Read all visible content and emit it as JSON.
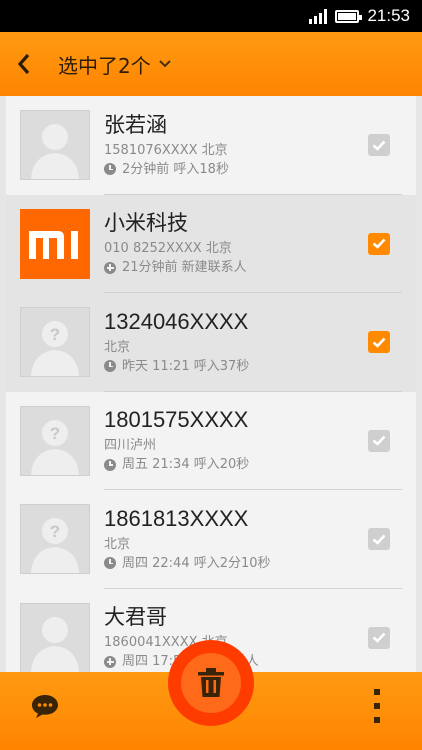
{
  "status_bar": {
    "time": "21:53"
  },
  "action_bar": {
    "title": "选中了2个"
  },
  "contacts": [
    {
      "name": "张若涵",
      "sub": "1581076XXXX 北京",
      "meta": "2分钟前 呼入18秒",
      "meta_icon": "clock-icon",
      "avatar": "person-silhouette",
      "selected": false
    },
    {
      "name": "小米科技",
      "sub": "010 8252XXXX  北京",
      "meta": "21分钟前 新建联系人",
      "meta_icon": "plus-icon",
      "avatar": "mi-logo",
      "selected": true
    },
    {
      "name": "1324046XXXX",
      "sub": "北京",
      "meta": "昨天 11:21 呼入37秒",
      "meta_icon": "clock-icon",
      "avatar": "unknown-person",
      "selected": true
    },
    {
      "name": "1801575XXXX",
      "sub": "四川泸州",
      "meta": "周五 21:34 呼入20秒",
      "meta_icon": "clock-icon",
      "avatar": "unknown-person",
      "selected": false
    },
    {
      "name": "1861813XXXX",
      "sub": "北京",
      "meta": "周四 22:44 呼入2分10秒",
      "meta_icon": "clock-icon",
      "avatar": "unknown-person",
      "selected": false
    },
    {
      "name": "大君哥",
      "sub": "1860041XXXX  北京",
      "meta": "周四 17:50 新建联系人",
      "meta_icon": "plus-icon",
      "avatar": "person-silhouette",
      "selected": false
    }
  ],
  "colors": {
    "accent": "#ff8a00",
    "delete": "#ff3c00",
    "list_bg": "#f3f3f3"
  },
  "bottom_bar": {
    "left_icon": "message-icon",
    "center_icon": "trash-icon",
    "right_icon": "more-vertical-icon"
  }
}
